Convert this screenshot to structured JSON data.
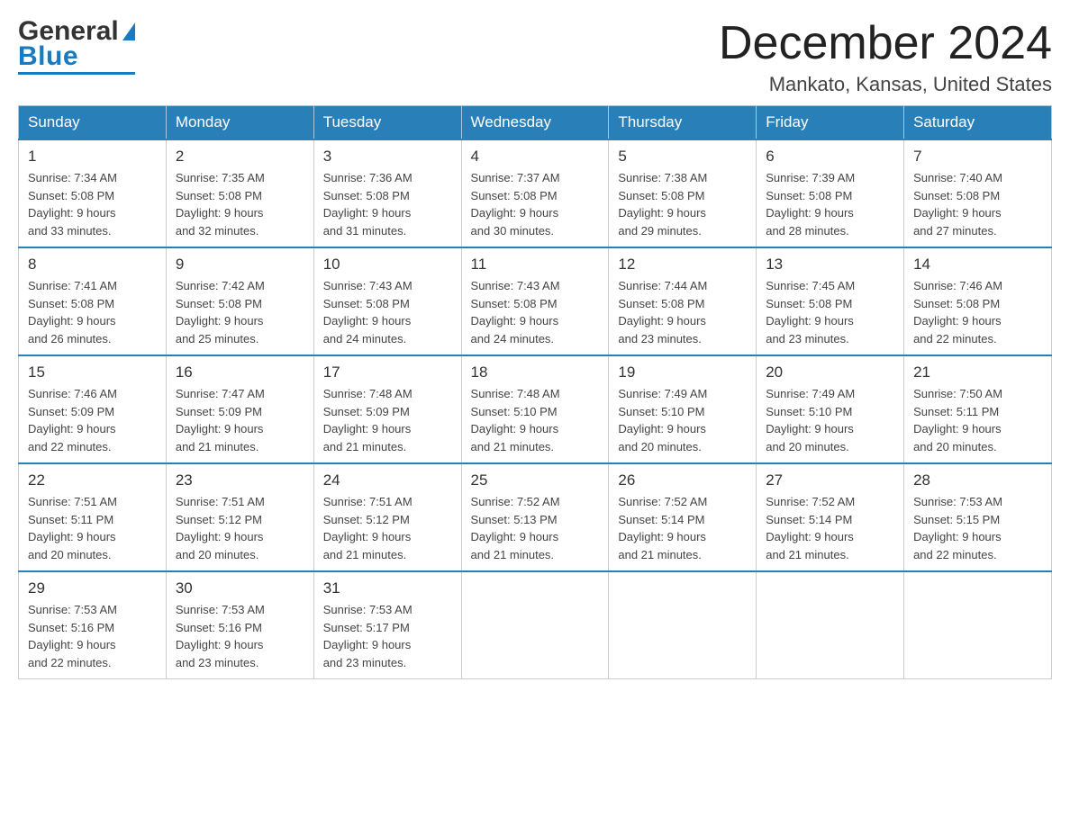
{
  "header": {
    "title": "December 2024",
    "subtitle": "Mankato, Kansas, United States",
    "logo_general": "General",
    "logo_blue": "Blue"
  },
  "weekdays": [
    "Sunday",
    "Monday",
    "Tuesday",
    "Wednesday",
    "Thursday",
    "Friday",
    "Saturday"
  ],
  "weeks": [
    [
      {
        "day": "1",
        "sunrise": "7:34 AM",
        "sunset": "5:08 PM",
        "daylight": "9 hours and 33 minutes."
      },
      {
        "day": "2",
        "sunrise": "7:35 AM",
        "sunset": "5:08 PM",
        "daylight": "9 hours and 32 minutes."
      },
      {
        "day": "3",
        "sunrise": "7:36 AM",
        "sunset": "5:08 PM",
        "daylight": "9 hours and 31 minutes."
      },
      {
        "day": "4",
        "sunrise": "7:37 AM",
        "sunset": "5:08 PM",
        "daylight": "9 hours and 30 minutes."
      },
      {
        "day": "5",
        "sunrise": "7:38 AM",
        "sunset": "5:08 PM",
        "daylight": "9 hours and 29 minutes."
      },
      {
        "day": "6",
        "sunrise": "7:39 AM",
        "sunset": "5:08 PM",
        "daylight": "9 hours and 28 minutes."
      },
      {
        "day": "7",
        "sunrise": "7:40 AM",
        "sunset": "5:08 PM",
        "daylight": "9 hours and 27 minutes."
      }
    ],
    [
      {
        "day": "8",
        "sunrise": "7:41 AM",
        "sunset": "5:08 PM",
        "daylight": "9 hours and 26 minutes."
      },
      {
        "day": "9",
        "sunrise": "7:42 AM",
        "sunset": "5:08 PM",
        "daylight": "9 hours and 25 minutes."
      },
      {
        "day": "10",
        "sunrise": "7:43 AM",
        "sunset": "5:08 PM",
        "daylight": "9 hours and 24 minutes."
      },
      {
        "day": "11",
        "sunrise": "7:43 AM",
        "sunset": "5:08 PM",
        "daylight": "9 hours and 24 minutes."
      },
      {
        "day": "12",
        "sunrise": "7:44 AM",
        "sunset": "5:08 PM",
        "daylight": "9 hours and 23 minutes."
      },
      {
        "day": "13",
        "sunrise": "7:45 AM",
        "sunset": "5:08 PM",
        "daylight": "9 hours and 23 minutes."
      },
      {
        "day": "14",
        "sunrise": "7:46 AM",
        "sunset": "5:08 PM",
        "daylight": "9 hours and 22 minutes."
      }
    ],
    [
      {
        "day": "15",
        "sunrise": "7:46 AM",
        "sunset": "5:09 PM",
        "daylight": "9 hours and 22 minutes."
      },
      {
        "day": "16",
        "sunrise": "7:47 AM",
        "sunset": "5:09 PM",
        "daylight": "9 hours and 21 minutes."
      },
      {
        "day": "17",
        "sunrise": "7:48 AM",
        "sunset": "5:09 PM",
        "daylight": "9 hours and 21 minutes."
      },
      {
        "day": "18",
        "sunrise": "7:48 AM",
        "sunset": "5:10 PM",
        "daylight": "9 hours and 21 minutes."
      },
      {
        "day": "19",
        "sunrise": "7:49 AM",
        "sunset": "5:10 PM",
        "daylight": "9 hours and 20 minutes."
      },
      {
        "day": "20",
        "sunrise": "7:49 AM",
        "sunset": "5:10 PM",
        "daylight": "9 hours and 20 minutes."
      },
      {
        "day": "21",
        "sunrise": "7:50 AM",
        "sunset": "5:11 PM",
        "daylight": "9 hours and 20 minutes."
      }
    ],
    [
      {
        "day": "22",
        "sunrise": "7:51 AM",
        "sunset": "5:11 PM",
        "daylight": "9 hours and 20 minutes."
      },
      {
        "day": "23",
        "sunrise": "7:51 AM",
        "sunset": "5:12 PM",
        "daylight": "9 hours and 20 minutes."
      },
      {
        "day": "24",
        "sunrise": "7:51 AM",
        "sunset": "5:12 PM",
        "daylight": "9 hours and 21 minutes."
      },
      {
        "day": "25",
        "sunrise": "7:52 AM",
        "sunset": "5:13 PM",
        "daylight": "9 hours and 21 minutes."
      },
      {
        "day": "26",
        "sunrise": "7:52 AM",
        "sunset": "5:14 PM",
        "daylight": "9 hours and 21 minutes."
      },
      {
        "day": "27",
        "sunrise": "7:52 AM",
        "sunset": "5:14 PM",
        "daylight": "9 hours and 21 minutes."
      },
      {
        "day": "28",
        "sunrise": "7:53 AM",
        "sunset": "5:15 PM",
        "daylight": "9 hours and 22 minutes."
      }
    ],
    [
      {
        "day": "29",
        "sunrise": "7:53 AM",
        "sunset": "5:16 PM",
        "daylight": "9 hours and 22 minutes."
      },
      {
        "day": "30",
        "sunrise": "7:53 AM",
        "sunset": "5:16 PM",
        "daylight": "9 hours and 23 minutes."
      },
      {
        "day": "31",
        "sunrise": "7:53 AM",
        "sunset": "5:17 PM",
        "daylight": "9 hours and 23 minutes."
      },
      null,
      null,
      null,
      null
    ]
  ],
  "labels": {
    "sunrise": "Sunrise:",
    "sunset": "Sunset:",
    "daylight": "Daylight:"
  }
}
